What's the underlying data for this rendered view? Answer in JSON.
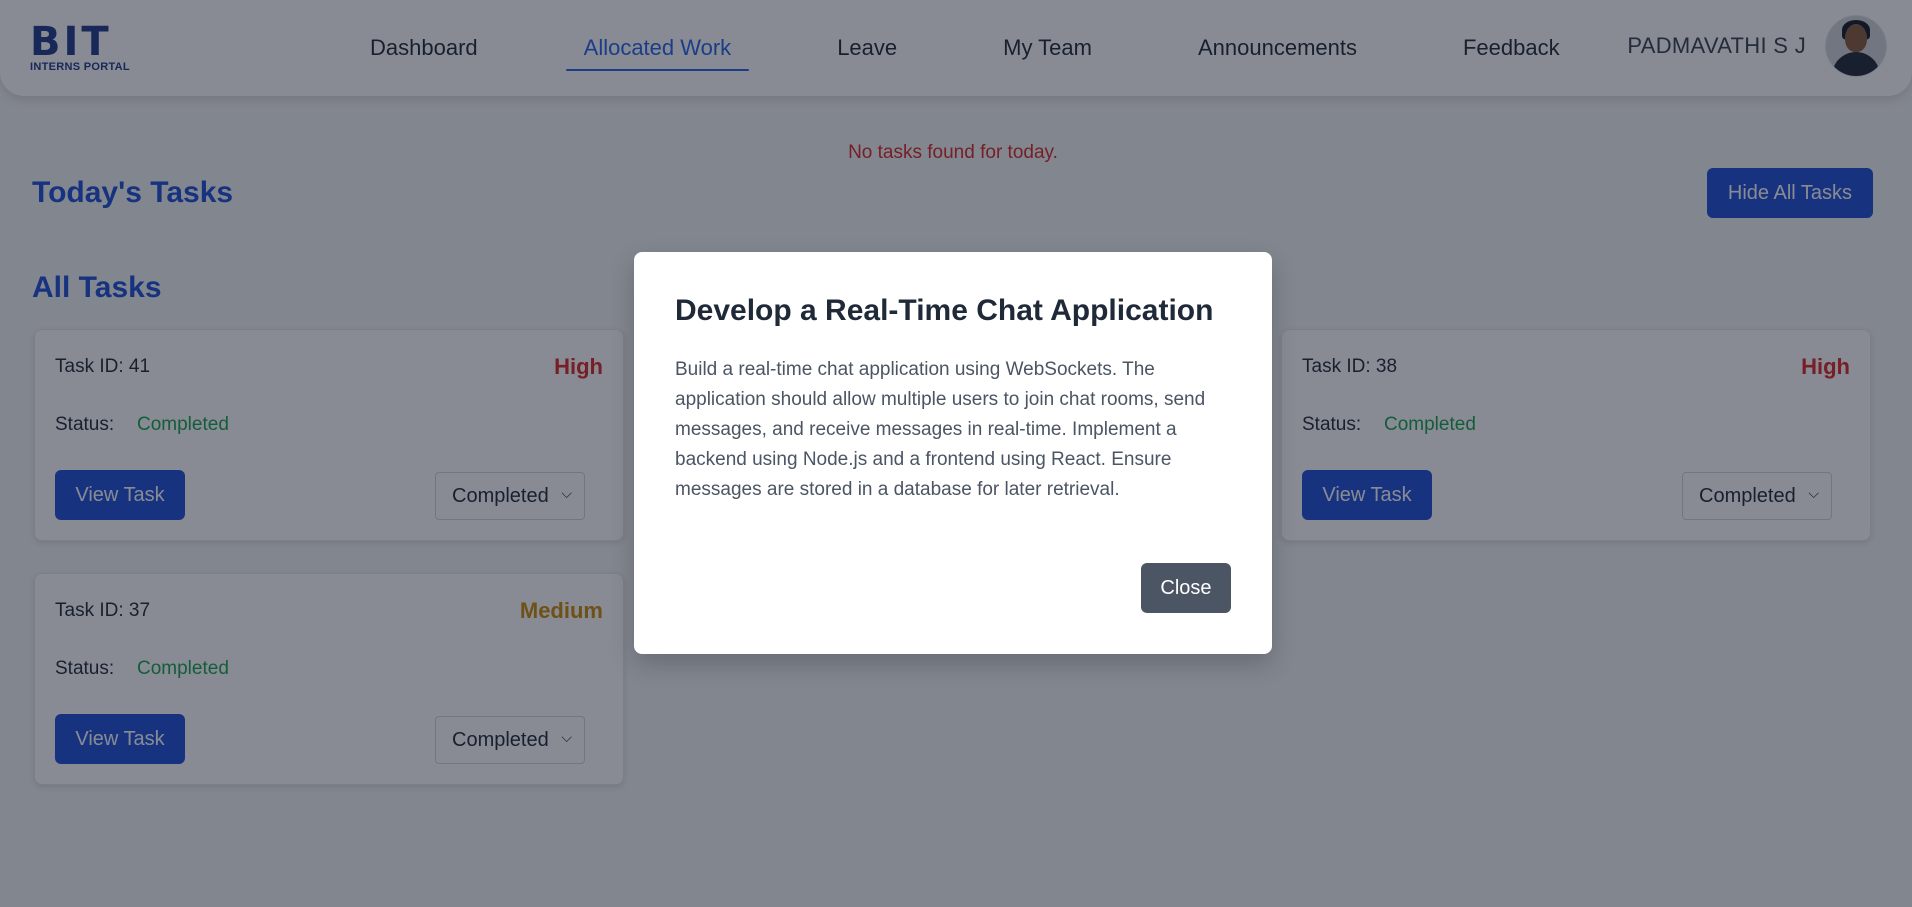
{
  "logo": {
    "main": "BIT",
    "sub": "INTERNS PORTAL"
  },
  "nav": {
    "items": [
      {
        "label": "Dashboard"
      },
      {
        "label": "Allocated Work",
        "active": true
      },
      {
        "label": "Leave"
      },
      {
        "label": "My Team"
      },
      {
        "label": "Announcements"
      },
      {
        "label": "Feedback"
      }
    ]
  },
  "user": {
    "name": "PADMAVATHI S J",
    "avatar_icon": "user-avatar"
  },
  "notice": "No tasks found for today.",
  "today": {
    "title": "Today's Tasks",
    "hide_label": "Hide All Tasks"
  },
  "all": {
    "title": "All Tasks"
  },
  "tasks": [
    {
      "id_label": "Task ID: 41",
      "priority": "High",
      "status_label": "Status:",
      "status": "Completed",
      "view_label": "View Task",
      "select_value": "Completed"
    },
    {
      "id_label": "Task ID: 38",
      "priority": "High",
      "status_label": "Status:",
      "status": "Completed",
      "view_label": "View Task",
      "select_value": "Completed"
    },
    {
      "id_label": "Task ID: 37",
      "priority": "Medium",
      "status_label": "Status:",
      "status": "Completed",
      "view_label": "View Task",
      "select_value": "Completed"
    }
  ],
  "modal": {
    "title": "Develop a Real-Time Chat Application",
    "description": "Build a real-time chat application using WebSockets. The application should allow multiple users to join chat rooms, send messages, and receive messages in real-time. Implement a backend using Node.js and a frontend using React. Ensure messages are stored in a database for later retrieval.",
    "close_label": "Close"
  },
  "colors": {
    "accent": "#1d4ed8",
    "high": "#dc2626",
    "medium": "#ca8a04",
    "completed": "#16a34a",
    "overlay": "rgba(17,24,39,0.5)"
  }
}
